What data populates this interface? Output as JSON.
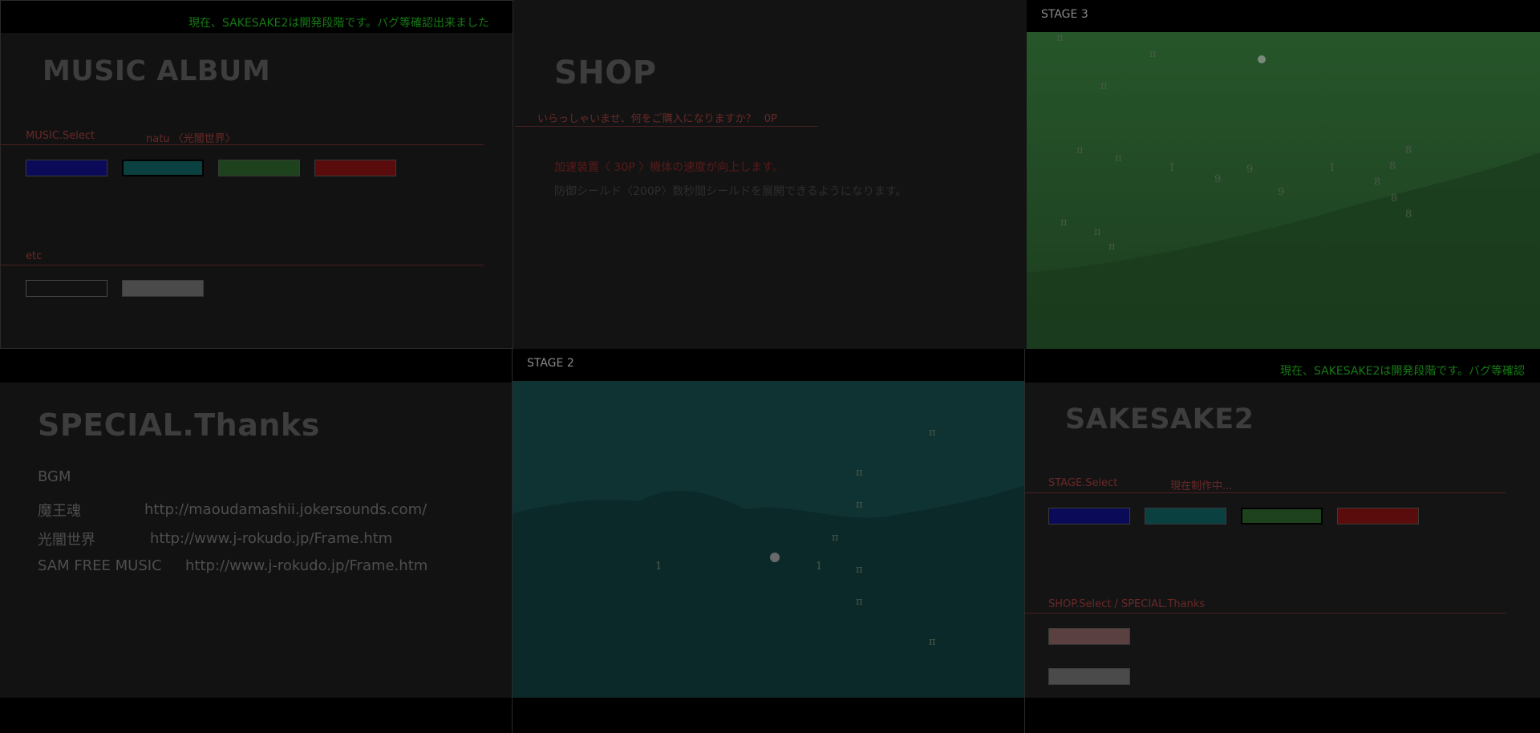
{
  "music_panel": {
    "ticker": "現在、SAKESAKE2は開発段階です。バグ等確認出来ました",
    "title": "MUSIC ALBUM",
    "select_label": "MUSIC.Select",
    "select_value": "natu 〈光闇世界〉",
    "etc_label": "etc",
    "color_buttons": [
      "#0a0a6a",
      "#0a4a4a",
      "#1e4a1e",
      "#6a0e0e"
    ],
    "etc_buttons": [
      "#151515",
      "#555555"
    ]
  },
  "shop_panel": {
    "title": "SHOP",
    "greeting": "いらっしゃいませ、何をご購入になりますか？",
    "points": "0P",
    "item1": "加速装置〈 30P 〉機体の速度が向上します。",
    "item2": "防御シールド〈200P〉数秒間シールドを展開できるようになります。"
  },
  "stage3_panel": {
    "title": "STAGE 3",
    "glyphs": {
      "pi": "π",
      "eight": "8",
      "nine": "9",
      "one": "1"
    }
  },
  "thanks_panel": {
    "title": "SPECIAL.Thanks",
    "bgm_label": "BGM",
    "credits": [
      {
        "name": "魔王魂",
        "url": "http://maoudamashii.jokersounds.com/"
      },
      {
        "name": "光闇世界",
        "url": "http://www.j-rokudo.jp/Frame.htm"
      },
      {
        "name": "SAM FREE MUSIC",
        "url": "http://www.j-rokudo.jp/Frame.htm"
      }
    ]
  },
  "stage2_panel": {
    "title": "STAGE 2",
    "glyph_pi": "π",
    "glyph_one": "1"
  },
  "menu_panel": {
    "ticker": "現在、SAKESAKE2は開発段階です。バグ等確認",
    "title": "SAKESAKE2",
    "stage_label": "STAGE.Select",
    "stage_value": "現在制作中...",
    "shop_label": "SHOP.Select / SPECIAL.Thanks",
    "stage_buttons": [
      "#0a0a6a",
      "#0a4a4a",
      "#1e4a1e",
      "#6a0e0e"
    ],
    "extra_buttons": [
      "#6a4a4a",
      "#555555"
    ]
  }
}
